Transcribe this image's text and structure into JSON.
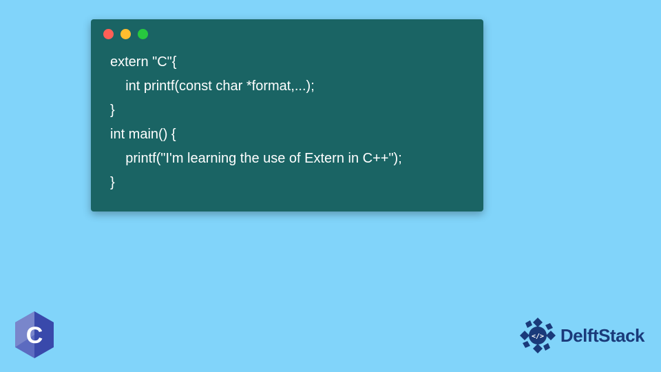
{
  "code": {
    "line1": "extern \"C\"{",
    "line2": "    int printf(const char *format,...);",
    "line3": "}",
    "line4": "int main() {",
    "line5": "    printf(\"I'm learning the use of Extern in C++\");",
    "line6": "}"
  },
  "logos": {
    "c_letter": "C",
    "brand": "DelftStack"
  },
  "colors": {
    "bg": "#81d4fa",
    "window": "#1a6464",
    "dot_red": "#ff5f56",
    "dot_yellow": "#ffbd2e",
    "dot_green": "#27c93f",
    "brand_blue": "#1a3a7a"
  }
}
